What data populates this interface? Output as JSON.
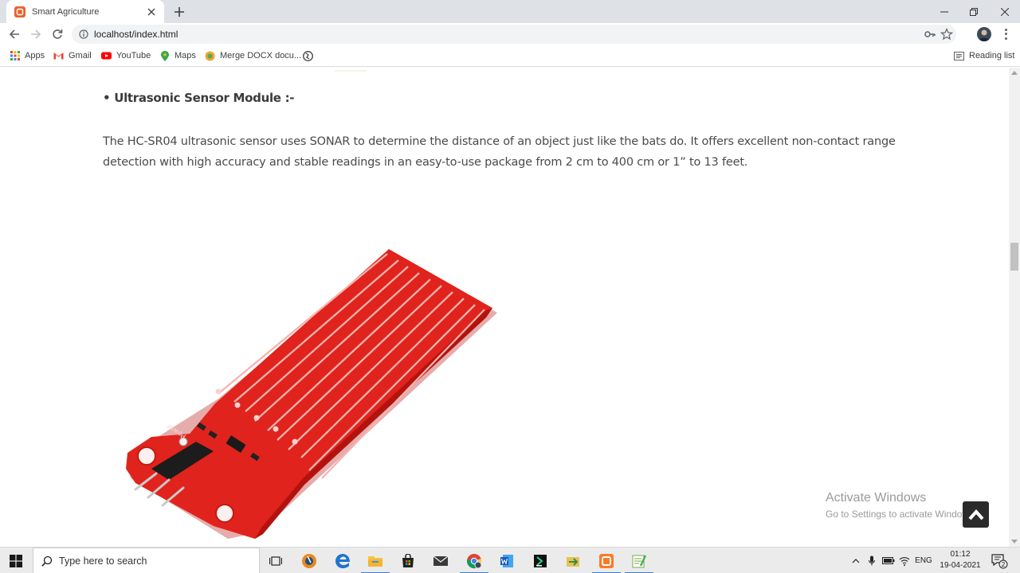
{
  "browser": {
    "tab": {
      "title": "Smart Agriculture",
      "favicon": "xampp-icon"
    },
    "address": {
      "url": "localhost/index.html"
    },
    "bookmarks": [
      {
        "label": "Apps",
        "icon": "apps-grid-icon"
      },
      {
        "label": "Gmail",
        "icon": "gmail-icon"
      },
      {
        "label": "YouTube",
        "icon": "youtube-icon"
      },
      {
        "label": "Maps",
        "icon": "maps-icon"
      },
      {
        "label": "Merge DOCX docu...",
        "icon": "merge-docx-icon"
      },
      {
        "label": "",
        "icon": "globe-icon"
      }
    ],
    "reading_list": "Reading list"
  },
  "page": {
    "heading": "• Ultrasonic Sensor Module :-",
    "paragraph_line1": "The HC-SR04 ultrasonic sensor uses SONAR to determine the distance of an object just like the bats do. It offers excellent non-contact range",
    "paragraph_line2": "detection with high accuracy and stable readings in an easy-to-use package from 2 cm to 400 cm or 1” to 13 feet.",
    "image": "water level sensor module (red PCB)"
  },
  "watermark": {
    "title": "Activate Windows",
    "subtitle": "Go to Settings to activate Windows."
  },
  "taskbar": {
    "search_placeholder": "Type here to search",
    "lang": "ENG",
    "time": "01:12",
    "date": "19-04-2021",
    "notifications": "2"
  },
  "colors": {
    "tabstrip": "#dee1e6",
    "pcb_red": "#e0231c",
    "taskbar": "#ebebeb"
  }
}
